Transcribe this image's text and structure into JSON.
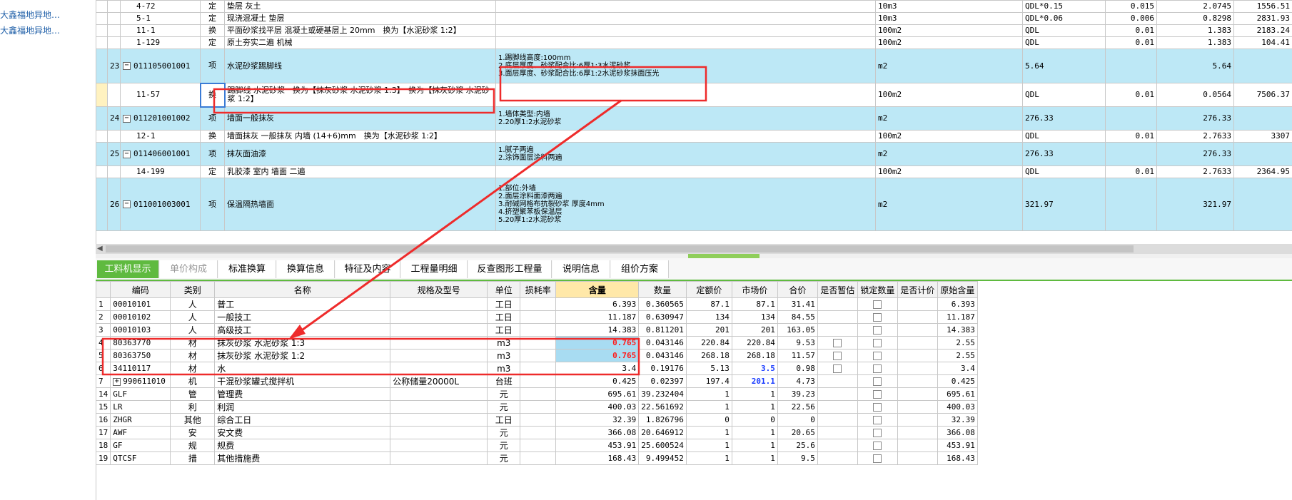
{
  "tree": {
    "items": [
      "大鑫福地异地…",
      "大鑫福地异地…"
    ]
  },
  "top_rows": [
    {
      "kind": "sub",
      "no": "",
      "code": "4-72",
      "type": "定",
      "name": "垫层 灰土",
      "feat": "",
      "unit": "10m3",
      "expr": "QDL*0.15",
      "qty": "0.015",
      "v1": "2.0745",
      "v2": "1556.51"
    },
    {
      "kind": "sub",
      "no": "",
      "code": "5-1",
      "type": "定",
      "name": "现浇混凝土 垫层",
      "feat": "",
      "unit": "10m3",
      "expr": "QDL*0.06",
      "qty": "0.006",
      "v1": "0.8298",
      "v2": "2831.93"
    },
    {
      "kind": "sub",
      "no": "",
      "code": "11-1",
      "type": "换",
      "name": "平面砂浆找平层 混凝土或硬基层上 20mm　换为【水泥砂浆 1:2】",
      "feat": "",
      "unit": "100m2",
      "expr": "QDL",
      "qty": "0.01",
      "v1": "1.383",
      "v2": "2183.24"
    },
    {
      "kind": "sub",
      "no": "",
      "code": "1-129",
      "type": "定",
      "name": "原土夯实二遍 机械",
      "feat": "",
      "unit": "100m2",
      "expr": "QDL",
      "qty": "0.01",
      "v1": "1.383",
      "v2": "104.41"
    },
    {
      "kind": "item",
      "no": "23",
      "code": "011105001001",
      "type": "项",
      "name": "水泥砂浆踢脚线",
      "feat": "1.踢脚线高度:100mm\n2.底层厚度、砂浆配合比:6厚1:3水泥砂浆\n3.面层厚度、砂浆配合比:6厚1:2水泥砂浆抹面压光",
      "unit": "m2",
      "expr": "5.64",
      "qty": "",
      "v1": "5.64",
      "v2": ""
    },
    {
      "kind": "sub",
      "no": "",
      "code": "11-57",
      "type": "换",
      "name": "踢脚线 水泥砂浆　换为【抹灰砂浆 水泥砂浆 1:3】　换为【抹灰砂浆 水泥砂浆 1:2】",
      "feat": "",
      "unit": "100m2",
      "expr": "QDL",
      "qty": "0.01",
      "v1": "0.0564",
      "v2": "7506.37"
    },
    {
      "kind": "item",
      "no": "24",
      "code": "011201001002",
      "type": "项",
      "name": "墙面一般抹灰",
      "feat": "1.墙体类型:内墙\n2.20厚1:2水泥砂浆",
      "unit": "m2",
      "expr": "276.33",
      "qty": "",
      "v1": "276.33",
      "v2": ""
    },
    {
      "kind": "sub",
      "no": "",
      "code": "12-1",
      "type": "换",
      "name": "墙面抹灰 一般抹灰 内墙 (14+6)mm　换为【水泥砂浆 1:2】",
      "feat": "",
      "unit": "100m2",
      "expr": "QDL",
      "qty": "0.01",
      "v1": "2.7633",
      "v2": "3307"
    },
    {
      "kind": "item",
      "no": "25",
      "code": "011406001001",
      "type": "项",
      "name": "抹灰面油漆",
      "feat": "1.腻子两遍\n2.涂饰面层涂料两遍",
      "unit": "m2",
      "expr": "276.33",
      "qty": "",
      "v1": "276.33",
      "v2": ""
    },
    {
      "kind": "sub",
      "no": "",
      "code": "14-199",
      "type": "定",
      "name": "乳胶漆 室内 墙面 二遍",
      "feat": "",
      "unit": "100m2",
      "expr": "QDL",
      "qty": "0.01",
      "v1": "2.7633",
      "v2": "2364.95"
    },
    {
      "kind": "item",
      "no": "26",
      "code": "011001003001",
      "type": "项",
      "name": "保温隔热墙面",
      "feat": "1.部位:外墙\n2.面层涂料面漆两遍\n3.耐碱网格布抗裂砂浆 厚度4mm\n4.挤塑聚苯板保温层\n5.20厚1:2水泥砂浆",
      "unit": "m2",
      "expr": "321.97",
      "qty": "",
      "v1": "321.97",
      "v2": ""
    }
  ],
  "tabs": [
    "工料机显示",
    "单价构成",
    "标准换算",
    "换算信息",
    "特征及内容",
    "工程量明细",
    "反查图形工程量",
    "说明信息",
    "组价方案"
  ],
  "bottom_headers": [
    "",
    "编码",
    "类别",
    "名称",
    "规格及型号",
    "单位",
    "损耗率",
    "含量",
    "数量",
    "定额价",
    "市场价",
    "合价",
    "是否暂估",
    "锁定数量",
    "是否计价",
    "原始含量"
  ],
  "bottom_rows": [
    {
      "no": "1",
      "code": "00010101",
      "cat": "人",
      "name": "普工",
      "spec": "",
      "unit": "工日",
      "loss": "",
      "content": "6.393",
      "qty": "0.360565",
      "quota": "87.1",
      "market": "87.1",
      "total": "31.41",
      "est": false,
      "lock": true,
      "orig": "6.393"
    },
    {
      "no": "2",
      "code": "00010102",
      "cat": "人",
      "name": "一般技工",
      "spec": "",
      "unit": "工日",
      "loss": "",
      "content": "11.187",
      "qty": "0.630947",
      "quota": "134",
      "market": "134",
      "total": "84.55",
      "est": false,
      "lock": true,
      "orig": "11.187"
    },
    {
      "no": "3",
      "code": "00010103",
      "cat": "人",
      "name": "高级技工",
      "spec": "",
      "unit": "工日",
      "loss": "",
      "content": "14.383",
      "qty": "0.811201",
      "quota": "201",
      "market": "201",
      "total": "163.05",
      "est": false,
      "lock": true,
      "orig": "14.383"
    },
    {
      "no": "4",
      "code": "80363770",
      "cat": "材",
      "name": "抹灰砂浆 水泥砂浆 1:3",
      "spec": "",
      "unit": "m3",
      "loss": "",
      "content": "0.765",
      "qty": "0.043146",
      "quota": "220.84",
      "market": "220.84",
      "total": "9.53",
      "est": true,
      "lock": true,
      "orig": "2.55"
    },
    {
      "no": "5",
      "code": "80363750",
      "cat": "材",
      "name": "抹灰砂浆 水泥砂浆 1:2",
      "spec": "",
      "unit": "m3",
      "loss": "",
      "content": "0.765",
      "qty": "0.043146",
      "quota": "268.18",
      "market": "268.18",
      "total": "11.57",
      "est": true,
      "lock": true,
      "orig": "2.55"
    },
    {
      "no": "6",
      "code": "34110117",
      "cat": "材",
      "name": "水",
      "spec": "",
      "unit": "m3",
      "loss": "",
      "content": "3.4",
      "qty": "0.19176",
      "quota": "5.13",
      "market": "3.5",
      "total": "0.98",
      "est": true,
      "lock": true,
      "orig": "3.4"
    },
    {
      "no": "7",
      "code": "990611010",
      "cat": "机",
      "name": "干混砂浆罐式搅拌机",
      "spec": "公称储量20000L",
      "unit": "台班",
      "loss": "",
      "content": "0.425",
      "qty": "0.02397",
      "quota": "197.4",
      "market": "201.1",
      "total": "4.73",
      "est": false,
      "lock": true,
      "orig": "0.425"
    },
    {
      "no": "14",
      "code": "GLF",
      "cat": "管",
      "name": "管理费",
      "spec": "",
      "unit": "元",
      "loss": "",
      "content": "695.61",
      "qty": "39.232404",
      "quota": "1",
      "market": "1",
      "total": "39.23",
      "est": false,
      "lock": true,
      "orig": "695.61"
    },
    {
      "no": "15",
      "code": "LR",
      "cat": "利",
      "name": "利润",
      "spec": "",
      "unit": "元",
      "loss": "",
      "content": "400.03",
      "qty": "22.561692",
      "quota": "1",
      "market": "1",
      "total": "22.56",
      "est": false,
      "lock": true,
      "orig": "400.03"
    },
    {
      "no": "16",
      "code": "ZHGR",
      "cat": "其他",
      "name": "综合工日",
      "spec": "",
      "unit": "工日",
      "loss": "",
      "content": "32.39",
      "qty": "1.826796",
      "quota": "0",
      "market": "0",
      "total": "0",
      "est": false,
      "lock": true,
      "orig": "32.39"
    },
    {
      "no": "17",
      "code": "AWF",
      "cat": "安",
      "name": "安文费",
      "spec": "",
      "unit": "元",
      "loss": "",
      "content": "366.08",
      "qty": "20.646912",
      "quota": "1",
      "market": "1",
      "total": "20.65",
      "est": false,
      "lock": true,
      "orig": "366.08"
    },
    {
      "no": "18",
      "code": "GF",
      "cat": "规",
      "name": "规费",
      "spec": "",
      "unit": "元",
      "loss": "",
      "content": "453.91",
      "qty": "25.600524",
      "quota": "1",
      "market": "1",
      "total": "25.6",
      "est": false,
      "lock": true,
      "orig": "453.91"
    },
    {
      "no": "19",
      "code": "QTCSF",
      "cat": "措",
      "name": "其他措施费",
      "spec": "",
      "unit": "元",
      "loss": "",
      "content": "168.43",
      "qty": "9.499452",
      "quota": "1",
      "market": "1",
      "total": "9.5",
      "est": false,
      "lock": true,
      "orig": "168.43"
    }
  ],
  "colors": {
    "item_bg": "#bde8f6",
    "tab_active": "#5fba3f",
    "highlight_red": "#ee2b2b"
  }
}
